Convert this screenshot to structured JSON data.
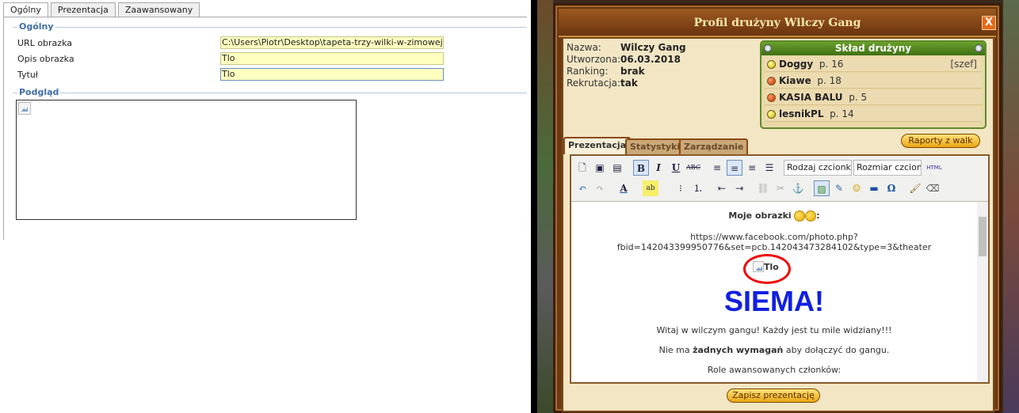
{
  "left": {
    "tabs": [
      "Ogólny",
      "Prezentacja",
      "Zaawansowany"
    ],
    "section_general": "Ogólny",
    "fields": [
      {
        "label": "URL obrazka",
        "value": "C:\\Users\\Piotr\\Desktop\\tapeta-trzy-wilki-w-zimowej-sce"
      },
      {
        "label": "Opis obrazka",
        "value": "Tlo"
      },
      {
        "label": "Tytuł",
        "value": "Tlo"
      }
    ],
    "section_preview": "Podgląd"
  },
  "game": {
    "window_title": "Profil drużyny Wilczy Gang",
    "close_label": "X",
    "info": [
      {
        "label": "Nazwa:",
        "value": "Wilczy Gang"
      },
      {
        "label": "Utworzona:",
        "value": "06.03.2018"
      },
      {
        "label": "Ranking:",
        "value": "brak"
      },
      {
        "label": "Rekrutacja:",
        "value": "tak"
      }
    ],
    "squad_title": "Skład drużyny",
    "members": [
      {
        "name": "Doggy",
        "level": "p. 16",
        "role": "[szef]",
        "status": "yellow"
      },
      {
        "name": "Kiawe",
        "level": "p. 18",
        "role": "",
        "status": "red"
      },
      {
        "name": "KASIA BALU",
        "level": "p. 5",
        "role": "",
        "status": "red"
      },
      {
        "name": "lesnikPL",
        "level": "p. 14",
        "role": "",
        "status": "yellow"
      }
    ],
    "reports_button": "Raporty z walk",
    "tabs": [
      "Prezentacja",
      "Statystyki",
      "Zarządzanie"
    ],
    "toolbar": {
      "font_family": "Rodzaj czcionk",
      "font_size": "Rozmiar czcion",
      "html": "HTML"
    },
    "doc": {
      "heading": "Moje obrazki",
      "heading_suffix": ":",
      "url_line1": "https://www.facebook.com/photo.php?",
      "url_line2": "fbid=142043399950776&set=pcb.142043473284102&type=3&theater",
      "img_alt": "Tlo",
      "big_text": "SIEMA!",
      "para1": "Witaj w wilczym gangu! Każdy jest tu mile widziany!!!",
      "para2_pre": "Nie ma ",
      "para2_bold": "żadnych wymagań",
      "para2_post": " aby dołączyć do gangu.",
      "para3": "Role awansowanych członków:"
    },
    "save_button": "Zapisz prezentację"
  }
}
